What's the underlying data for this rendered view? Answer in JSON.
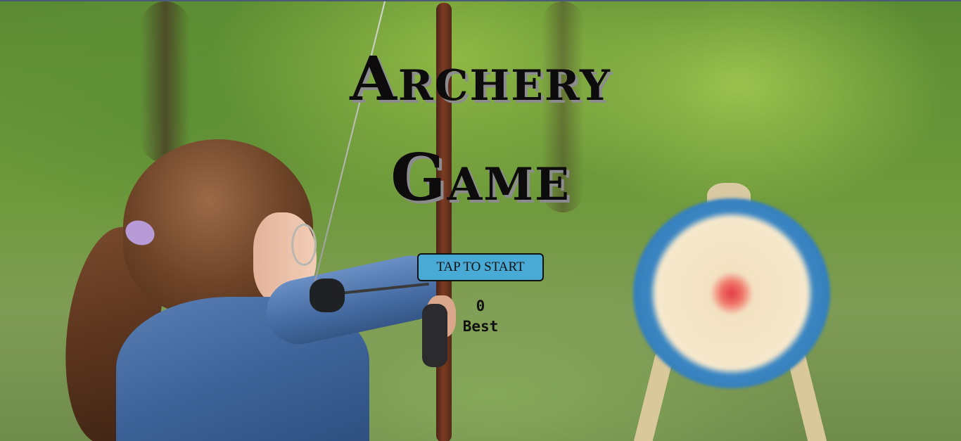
{
  "game": {
    "title_line1": "Archery",
    "title_line2": "Game",
    "start_button_label": "TAP TO START",
    "score": "0",
    "best_label": "Best"
  },
  "background": {
    "description_icon": "archer-with-target-photo"
  },
  "colors": {
    "button_bg": "#4aaad6",
    "title_text": "#0d0b0b",
    "title_shadow": "#8c8c90"
  }
}
